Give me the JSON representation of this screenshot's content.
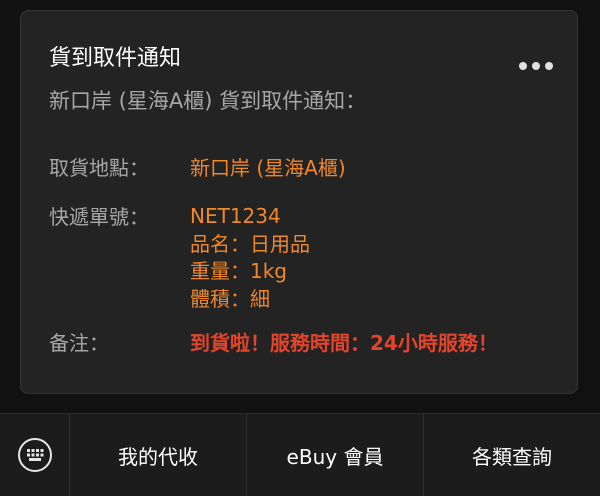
{
  "card": {
    "title": "貨到取件通知",
    "subtitle": "新口岸 (星海A櫃) 貨到取件通知：",
    "more_icon": "more-horizontal-icon",
    "rows": [
      {
        "label": "取貨地點：",
        "value": "新口岸 (星海A櫃)"
      },
      {
        "label": "快遞單號：",
        "lines": [
          "NET1234",
          "品名：日用品",
          "重量：1kg",
          "體積：細"
        ]
      },
      {
        "label": "备注：",
        "value": "到貨啦！服務時間：24小時服務！"
      }
    ]
  },
  "bottombar": {
    "keyboard_icon": "keyboard-icon",
    "tabs": [
      "我的代收",
      "eBuy 會員",
      "各類查詢"
    ]
  },
  "colors": {
    "accent_orange": "#f0882a",
    "alert_red": "#e2442c",
    "card_bg": "#232323",
    "page_bg": "#111111"
  }
}
